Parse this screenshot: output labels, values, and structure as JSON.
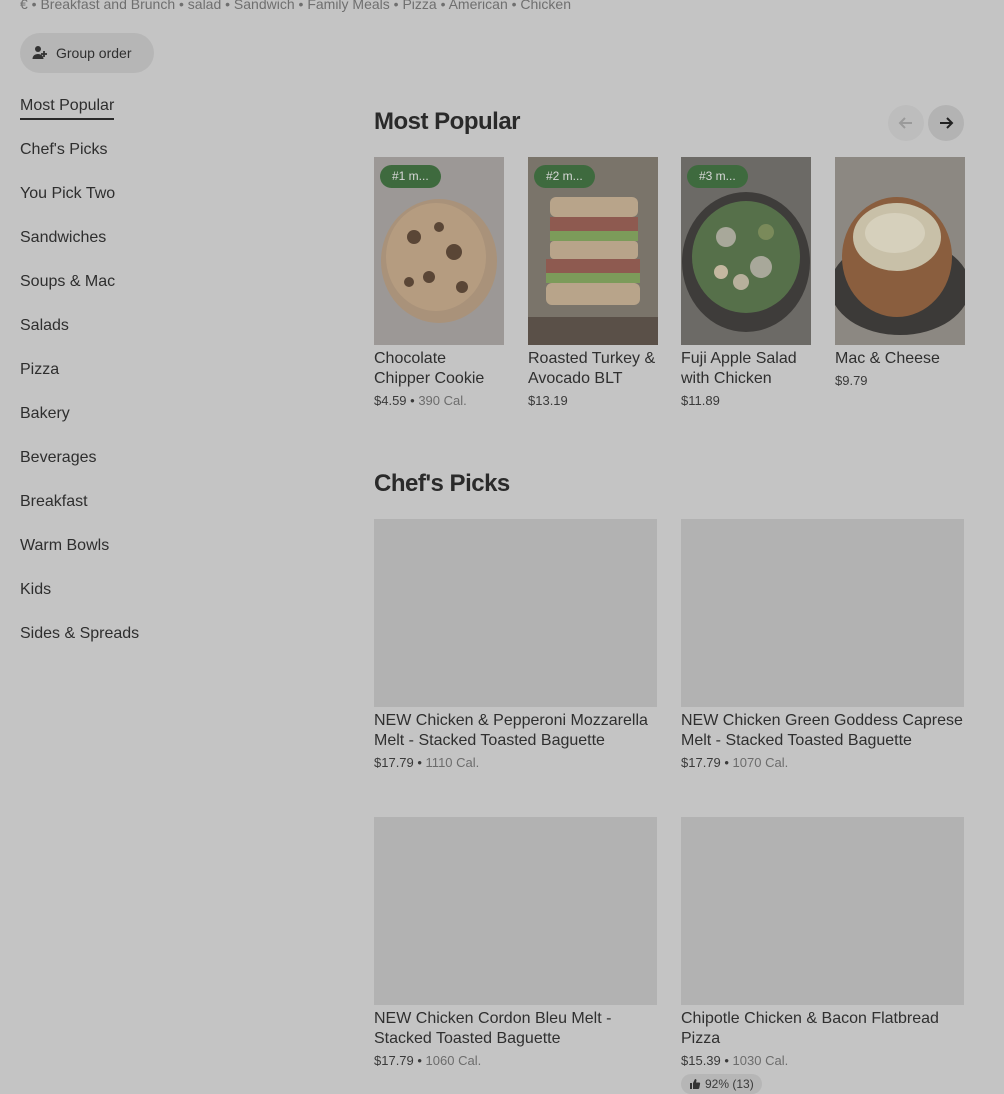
{
  "store": {
    "cuisines": "€ • Breakfast and Brunch • salad • Sandwich • Family Meals • Pizza • American • Chicken",
    "group_order_label": "Group order"
  },
  "sidebar": {
    "items": [
      {
        "label": "Most Popular"
      },
      {
        "label": "Chef's Picks"
      },
      {
        "label": "You Pick Two"
      },
      {
        "label": "Sandwiches"
      },
      {
        "label": "Soups & Mac"
      },
      {
        "label": "Salads"
      },
      {
        "label": "Pizza"
      },
      {
        "label": "Bakery"
      },
      {
        "label": "Beverages"
      },
      {
        "label": "Breakfast"
      },
      {
        "label": "Warm Bowls"
      },
      {
        "label": "Kids"
      },
      {
        "label": "Sides & Spreads"
      }
    ]
  },
  "most_popular": {
    "title": "Most Popular",
    "items": [
      {
        "badge": "#1 m...",
        "name": "Chocolate Chipper Cookie",
        "price": "$4.59",
        "calories": "390 Cal."
      },
      {
        "badge": "#2 m...",
        "name": "Roasted Turkey & Avocado BLT",
        "price": "$13.19",
        "calories": ""
      },
      {
        "badge": "#3 m...",
        "name": "Fuji Apple Salad with Chicken",
        "price": "$11.89",
        "calories": ""
      },
      {
        "badge": "",
        "name": "Mac & Cheese",
        "price": "$9.79",
        "calories": ""
      }
    ]
  },
  "chefs_picks": {
    "title": "Chef's Picks",
    "items": [
      {
        "name": "NEW Chicken & Pepperoni Mozzarella Melt - Stacked Toasted Baguette",
        "price": "$17.79",
        "calories": "1110 Cal."
      },
      {
        "name": "NEW Chicken Green Goddess Caprese Melt - Stacked Toasted Baguette",
        "price": "$17.79",
        "calories": "1070 Cal."
      },
      {
        "name": "NEW Chicken Cordon Bleu Melt - Stacked Toasted Baguette",
        "price": "$17.79",
        "calories": "1060 Cal."
      },
      {
        "name": "Chipotle Chicken & Bacon Flatbread Pizza",
        "price": "$15.39",
        "calories": "1030 Cal.",
        "rating": "92% (13)"
      }
    ]
  },
  "icons": {
    "group": "person-add-icon",
    "prev": "arrow-left-icon",
    "next": "arrow-right-icon",
    "rating": "thumbs-up-icon"
  },
  "colors": {
    "overlay_background": "#c4c4c4",
    "badge_green": "#3e6a3e"
  }
}
